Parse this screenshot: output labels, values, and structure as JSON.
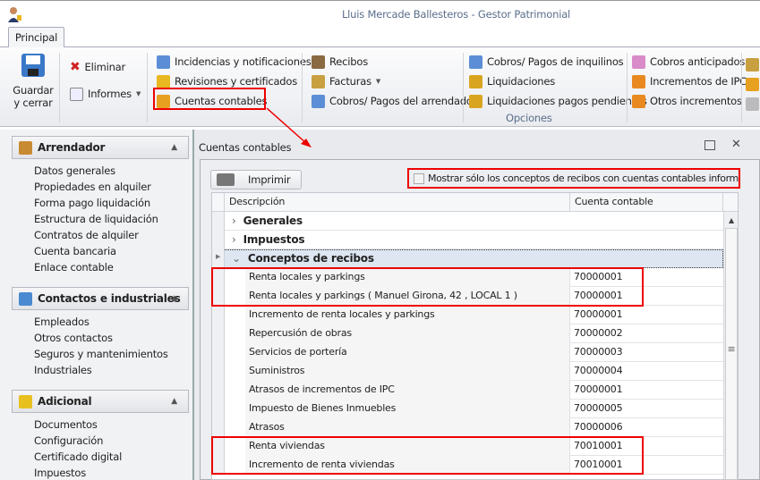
{
  "window": {
    "title": "Lluis Mercade Ballesteros - Gestor Patrimonial"
  },
  "ribbon": {
    "tab": "Principal",
    "save": "Guardar\ny cerrar",
    "eliminar": "Eliminar",
    "informes": "Informes",
    "items": [
      {
        "label": "Incidencias y notificaciones",
        "icon": "notification-icon",
        "color": "#5b8ed6"
      },
      {
        "label": "Revisiones y certificados",
        "icon": "bell-certificate-icon",
        "color": "#e8b820"
      },
      {
        "label": "Cuentas contables",
        "icon": "accounts-icon",
        "color": "#e8a020"
      },
      {
        "label": "Recibos",
        "icon": "receipt-icon",
        "color": "#8a6a40"
      },
      {
        "label": "Facturas",
        "icon": "invoice-icon",
        "color": "#c8a040"
      },
      {
        "label": "Cobros/ Pagos del arrendador",
        "icon": "calculator-icon",
        "color": "#5b8ed6"
      },
      {
        "label": "Cobros/ Pagos de inquilinos",
        "icon": "tenant-payments-icon",
        "color": "#5b8ed6"
      },
      {
        "label": "Liquidaciones",
        "icon": "settlement-icon",
        "color": "#d9a520"
      },
      {
        "label": "Liquidaciones pagos pendientes",
        "icon": "pending-settlement-icon",
        "color": "#d9a520"
      },
      {
        "label": "Cobros anticipados",
        "icon": "piggy-bank-icon",
        "color": "#d98ac8"
      },
      {
        "label": "Incrementos de IPC",
        "icon": "increase-icon",
        "color": "#e88a20"
      },
      {
        "label": "Otros incrementos",
        "icon": "increase-icon",
        "color": "#e88a20"
      }
    ],
    "group_label": "Opciones"
  },
  "sidebar": {
    "sections": [
      {
        "title": "Arrendador",
        "items": [
          "Datos generales",
          "Propiedades en alquiler",
          "Forma pago liquidación",
          "Estructura de liquidación",
          "Contratos de alquiler",
          "Cuenta bancaria",
          "Enlace contable"
        ]
      },
      {
        "title": "Contactos e industriales",
        "items": [
          "Empleados",
          "Otros contactos",
          "Seguros y mantenimientos",
          "Industriales"
        ]
      },
      {
        "title": "Adicional",
        "items": [
          "Documentos",
          "Configuración",
          "Certificado digital",
          "Impuestos"
        ]
      }
    ]
  },
  "panel": {
    "title": "Cuentas contables",
    "print": "Imprimir",
    "filter_label": "Mostrar sólo los conceptos de recibos con cuentas contables informadas",
    "filter_checked": false,
    "columns": [
      "Descripción",
      "Cuenta contable"
    ],
    "groups": [
      {
        "label": "Generales",
        "expanded": false
      },
      {
        "label": "Impuestos",
        "expanded": false
      },
      {
        "label": "Conceptos de recibos",
        "expanded": true
      }
    ],
    "rows": [
      {
        "desc": "Renta locales y parkings",
        "account": "70000001"
      },
      {
        "desc": "Renta locales y parkings ( Manuel Girona, 42 , LOCAL 1 )",
        "account": "70000001"
      },
      {
        "desc": "Incremento de renta locales y parkings",
        "account": "70000001"
      },
      {
        "desc": "Repercusión de obras",
        "account": "70000002"
      },
      {
        "desc": "Servicios de portería",
        "account": "70000003"
      },
      {
        "desc": "Suministros",
        "account": "70000004"
      },
      {
        "desc": "Atrasos de incrementos de IPC",
        "account": "70000001"
      },
      {
        "desc": "Impuesto de Bienes Inmuebles",
        "account": "70000005"
      },
      {
        "desc": "Atrasos",
        "account": "70000006"
      },
      {
        "desc": "Renta viviendas",
        "account": "70010001"
      },
      {
        "desc": "Incremento de renta viviendas",
        "account": "70010001"
      }
    ]
  },
  "colors": {
    "highlight": "#e00000",
    "accent_text": "#5a6e8a"
  }
}
